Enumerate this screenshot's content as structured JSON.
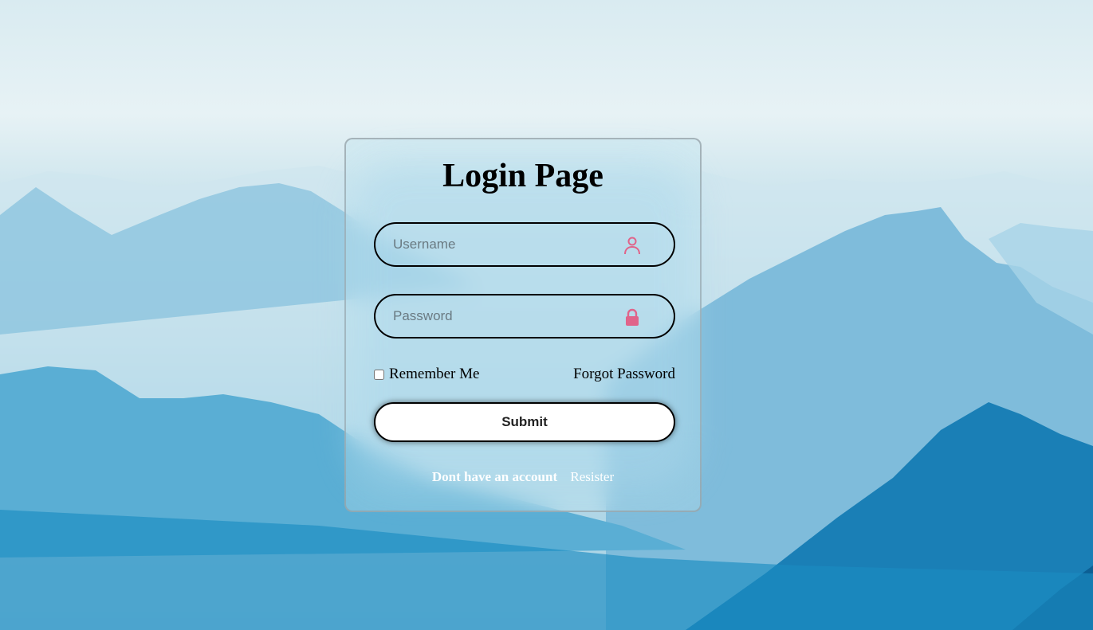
{
  "page": {
    "title": "Login Page"
  },
  "form": {
    "username": {
      "value": "",
      "placeholder": "Username",
      "icon": "user-icon"
    },
    "password": {
      "value": "",
      "placeholder": "Password",
      "icon": "lock-icon"
    },
    "remember_label": "Remember Me",
    "remember_checked": false,
    "forgot_label": "Forgot Password",
    "submit_label": "Submit",
    "register_prompt": "Dont have an account",
    "register_link": "Resister"
  },
  "colors": {
    "icon_accent": "#e0648a",
    "border": "#000000",
    "submit_bg": "#ffffff"
  }
}
